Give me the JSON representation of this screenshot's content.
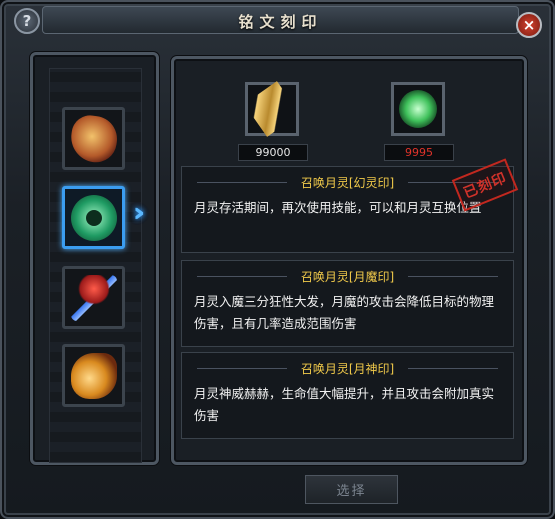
{
  "title": "铭文刻印",
  "help_label": "?",
  "close_label": "×",
  "left_slots": [
    {
      "icon": "gem-nut-icon"
    },
    {
      "icon": "jade-disc-icon",
      "selected": true
    },
    {
      "icon": "amulet-icon"
    },
    {
      "icon": "golden-horn-icon"
    }
  ],
  "materials": [
    {
      "icon": "scroll-icon",
      "count": "99000"
    },
    {
      "icon": "green-orb-icon",
      "count": "9995"
    }
  ],
  "options": [
    {
      "title": "召唤月灵[幻灵印]",
      "text": "月灵存活期间，再次使用技能，可以和月灵互换位置"
    },
    {
      "title": "召唤月灵[月魔印]",
      "text": "月灵入魔三分狂性大发，月魔的攻击会降低目标的物理伤害，且有几率造成范围伤害"
    },
    {
      "title": "召唤月灵[月神印]",
      "text": "月灵神威赫赫，生命值大幅提升，并且攻击会附加真实伤害"
    }
  ],
  "stamp": "已刻印",
  "select_label": "选择"
}
